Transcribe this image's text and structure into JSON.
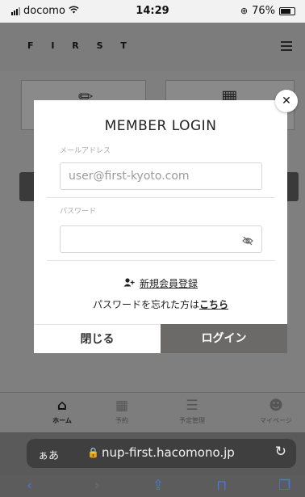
{
  "status": {
    "carrier": "docomo",
    "time": "14:29",
    "battery": "76%",
    "battery_level": 0.76
  },
  "header": {
    "logo": "F I R S T"
  },
  "modal": {
    "title": "MEMBER LOGIN",
    "email_label": "メールアドレス",
    "email_placeholder": "user@first-kyoto.com",
    "password_label": "パスワード",
    "password_value": "",
    "register_link": "新規会員登録",
    "forgot_prefix": "パスワードを忘れた方は",
    "forgot_link": "こちら",
    "close_label": "閉じる",
    "login_label": "ログイン"
  },
  "tabbar": {
    "items": [
      {
        "label": "ホーム",
        "icon": "home-icon",
        "active": true
      },
      {
        "label": "予約",
        "icon": "calendar-icon",
        "active": false
      },
      {
        "label": "予定管理",
        "icon": "list-icon",
        "active": false
      },
      {
        "label": "マイページ",
        "icon": "user-icon",
        "active": false
      }
    ]
  },
  "browser": {
    "aa": "ぁあ",
    "url": "nup-first.hacomono.jp"
  },
  "colors": {
    "login_button": "#6b6a69",
    "overlay": "#7f7f7f",
    "safari_link": "#4a78d8"
  }
}
